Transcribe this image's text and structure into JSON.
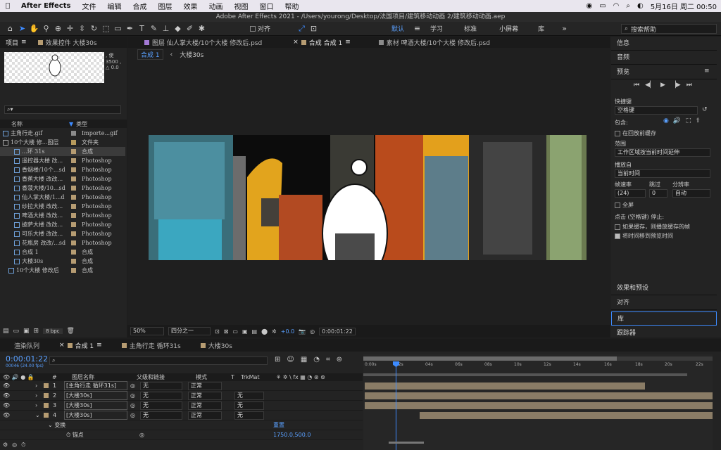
{
  "menubar": {
    "app_name": "After Effects",
    "items": [
      "文件",
      "编辑",
      "合成",
      "图层",
      "效果",
      "动画",
      "视图",
      "窗口",
      "帮助"
    ],
    "datetime": "5月16日 周二  00:50"
  },
  "titlebar": {
    "title": "Adobe After Effects 2021 - /Users/yourong/Desktop/法国项目/建筑移动动画 2/建筑移动动画.aep"
  },
  "toolbar": {
    "align_label": "对齐",
    "workspaces": [
      "默认",
      "学习",
      "标准",
      "小屏幕",
      "库"
    ],
    "search_placeholder": "搜索帮助"
  },
  "project_panel": {
    "tabs": [
      "项目",
      "效果控件 大楼30s"
    ],
    "thumb_info": ", 使\n3500 ,\n△ 0.0",
    "columns": {
      "name": "名称",
      "type": "类型"
    },
    "items": [
      {
        "name": "主角行走.gif",
        "type": "Importe...gif",
        "color": "#8b8b8b"
      },
      {
        "name": "10个大楼 修...图层",
        "type": "文件夹",
        "color": "#b79a5c"
      },
      {
        "name": "...环 31s",
        "type": "合成",
        "color": "#b69c72"
      },
      {
        "name": "遥控器大楼 改...",
        "type": "Photoshop",
        "color": "#b69c72"
      },
      {
        "name": "香烟楼/10个...sd",
        "type": "Photoshop",
        "color": "#b69c72"
      },
      {
        "name": "香蕉大楼 改改...",
        "type": "Photoshop",
        "color": "#b69c72"
      },
      {
        "name": "香菠大楼/10...sd",
        "type": "Photoshop",
        "color": "#b69c72"
      },
      {
        "name": "仙人掌大楼/1...d",
        "type": "Photoshop",
        "color": "#b69c72"
      },
      {
        "name": "纱拉大楼 改改...",
        "type": "Photoshop",
        "color": "#b69c72"
      },
      {
        "name": "啤酒大楼 改改...",
        "type": "Photoshop",
        "color": "#b69c72"
      },
      {
        "name": "披萨大楼 改改...",
        "type": "Photoshop",
        "color": "#b69c72"
      },
      {
        "name": "可乐大楼 改改...",
        "type": "Photoshop",
        "color": "#b69c72"
      },
      {
        "name": "花瓶房 改改/...sd",
        "type": "Photoshop",
        "color": "#b69c72"
      },
      {
        "name": "合成 1",
        "type": "合成",
        "color": "#b69c72"
      },
      {
        "name": "大楼30s",
        "type": "合成",
        "color": "#b69c72"
      },
      {
        "name": "10个大楼 修改后",
        "type": "合成",
        "color": "#b69c72"
      }
    ],
    "bpc": "8 bpc"
  },
  "viewer": {
    "tabs": [
      "图层 仙人掌大楼/10个大楼 修改后.psd",
      "合成 合成 1",
      "素材 啤酒大楼/10个大楼 修改后.psd"
    ],
    "breadcrumbs": [
      "合成 1",
      "大楼30s"
    ],
    "zoom": "50%",
    "resolution": "四分之一",
    "exposure": "+0.0",
    "timecode": "0:00:01:22"
  },
  "right_panel": {
    "info": "信息",
    "audio": "音频",
    "preview": "预览",
    "shortcut_label": "快捷键",
    "shortcut_value": "空格键",
    "include_label": "包含:",
    "cache_before": "在回放前缓存",
    "range_label": "范围",
    "range_value": "工作区域按当前时间延伸",
    "play_from_label": "播放自",
    "play_from_value": "当前时间",
    "framerate_label": "帧速率",
    "skip_label": "跳过",
    "resolution_label": "分辨率",
    "framerate_value": "(24)",
    "skip_value": "0",
    "resolution_value": "自动",
    "fullscreen": "全屏",
    "stop_label": "点击 (空格键) 停止:",
    "stop_opt1": "如果缓存，则播放缓存的帧",
    "stop_opt2": "将时间移到预览时间",
    "effects": "效果和预设",
    "align": "对齐",
    "library": "库",
    "tracker": "跟踪器"
  },
  "timeline": {
    "tabs": [
      "渲染队列",
      "合成 1",
      "主角行走 循环31s",
      "大楼30s"
    ],
    "timecode": "0:00:01:22",
    "timecode_sub": "00046 (24.00 fps)",
    "col_layer": "图层名称",
    "col_parent": "父级和链接",
    "col_mode": "模式",
    "col_t": "T",
    "col_trkmat": "TrkMat",
    "ruler": [
      "0:00s",
      "02s",
      "04s",
      "06s",
      "08s",
      "10s",
      "12s",
      "14s",
      "16s",
      "18s",
      "20s",
      "22s"
    ],
    "layers": [
      {
        "num": "1",
        "name": "[主角行走 循环31s]",
        "parent": "无",
        "mode": "正常",
        "trk": ""
      },
      {
        "num": "2",
        "name": "[大楼30s]",
        "parent": "无",
        "mode": "正常",
        "trk": "无"
      },
      {
        "num": "3",
        "name": "[大楼30s]",
        "parent": "无",
        "mode": "正常",
        "trk": "无"
      },
      {
        "num": "4",
        "name": "[大楼30s]",
        "parent": "无",
        "mode": "正常",
        "trk": "无"
      }
    ],
    "transform": "变换",
    "reset": "重置",
    "anchor": "锚点",
    "anchor_value": "1750.0,500.0"
  }
}
